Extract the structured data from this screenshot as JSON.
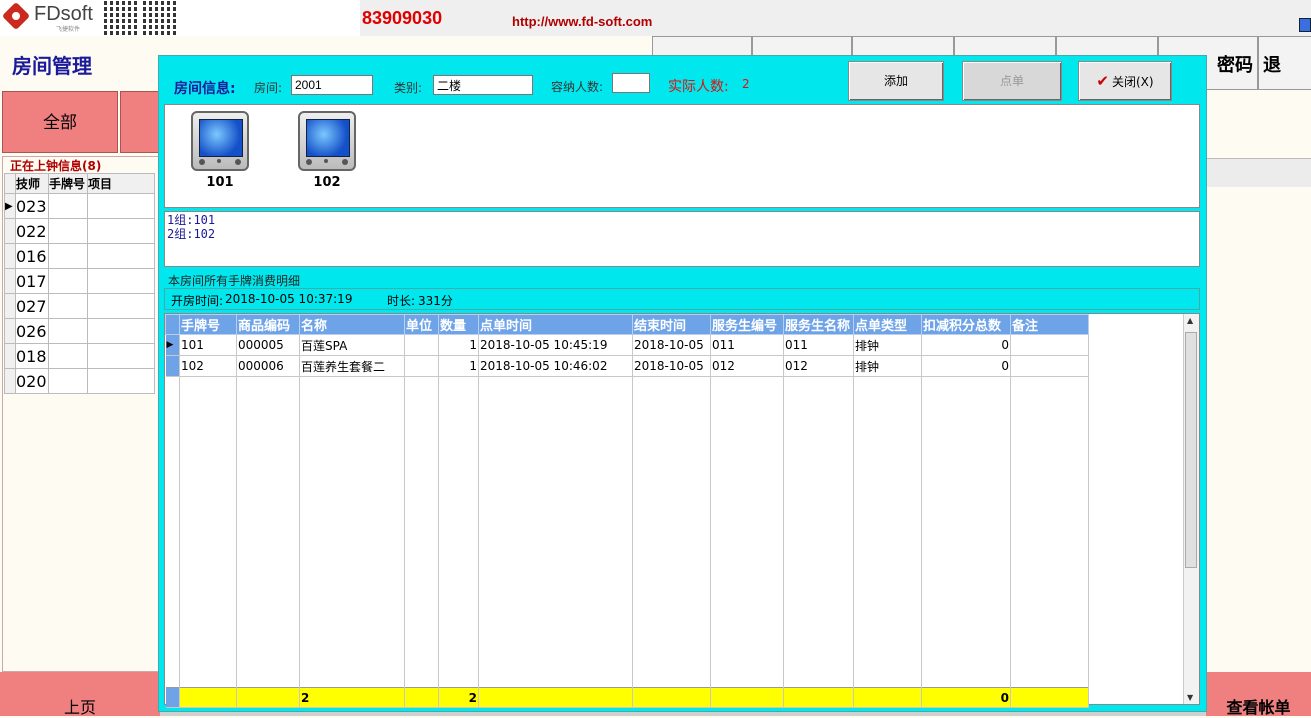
{
  "header": {
    "logo_text": "FDsoft",
    "logo_sub": "飞捷软件",
    "phone": "83909030",
    "url": "http://www.fd-soft.com",
    "page_title": "房间管理",
    "password_label": "密码",
    "exit_label": "退"
  },
  "left": {
    "all_label": "全部",
    "on_clock_label": "正在上钟信息(8)",
    "columns": [
      "技师",
      "手牌号",
      "项目"
    ],
    "techs": [
      "023",
      "022",
      "016",
      "017",
      "027",
      "026",
      "018",
      "020"
    ],
    "prev_label": "上页"
  },
  "right": {
    "view_bill_label": "查看帐单"
  },
  "dialog": {
    "info_label": "房间信息:",
    "room_label": "房间:",
    "room_value": "2001",
    "type_label": "类别:",
    "type_value": "二楼",
    "capacity_label": "容纳人数:",
    "capacity_value": "",
    "actual_label": "实际人数:",
    "actual_value": "2",
    "add_label": "添加",
    "order_label": "点单",
    "close_label": "关闭(X)",
    "cards": [
      "101",
      "102"
    ],
    "groups": [
      "1组:101",
      "2组:102"
    ],
    "detail_title": "本房间所有手牌消费明细",
    "open_time_label": "开房时间:",
    "open_time": "2018-10-05 10:37:19",
    "duration_label": "时长:",
    "duration": "331分",
    "table": {
      "columns": [
        "手牌号",
        "商品编码",
        "名称",
        "单位",
        "数量",
        "点单时间",
        "结束时间",
        "服务生编号",
        "服务生名称",
        "点单类型",
        "扣减积分总数",
        "备注"
      ],
      "rows": [
        [
          "101",
          "000005",
          "百莲SPA",
          "",
          "1",
          "2018-10-05 10:45:19",
          "2018-10-05",
          "011",
          "011",
          "排钟",
          "0",
          ""
        ],
        [
          "102",
          "000006",
          "百莲养生套餐二",
          "",
          "1",
          "2018-10-05 10:46:02",
          "2018-10-05",
          "012",
          "012",
          "排钟",
          "0",
          ""
        ]
      ],
      "totals": [
        "",
        "",
        "2",
        "",
        "2",
        "",
        "",
        "",
        "",
        "",
        "0",
        ""
      ]
    }
  }
}
